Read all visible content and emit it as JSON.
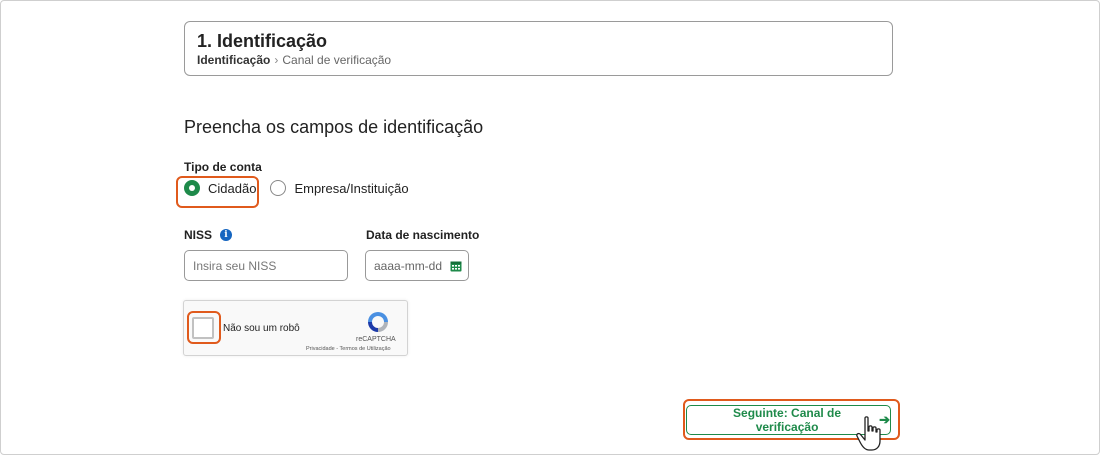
{
  "step": {
    "title": "1. Identificação",
    "breadcrumb": {
      "current": "Identificação",
      "separator": ">",
      "next": "Canal de verificação"
    }
  },
  "form": {
    "heading": "Preencha os campos de identificação",
    "account_type": {
      "label": "Tipo de conta",
      "options": [
        {
          "label": "Cidadão",
          "selected": true
        },
        {
          "label": "Empresa/Instituição",
          "selected": false
        }
      ]
    },
    "niss": {
      "label": "NISS",
      "placeholder": "Insira seu NISS",
      "value": ""
    },
    "birth_date": {
      "label": "Data de nascimento",
      "placeholder": "aaaa-mm-dd"
    },
    "captcha": {
      "label": "Não sou um robô",
      "brand": "reCAPTCHA",
      "links": "Privacidade - Termos de Utilização",
      "checked": false
    },
    "next_button": {
      "label": "Seguinte: Canal de verificação"
    }
  },
  "colors": {
    "accent": "#1e8a4a",
    "highlight": "#e05a1c",
    "info": "#1565c0"
  },
  "icons": {
    "info": "info-icon",
    "calendar": "calendar-icon",
    "arrow": "arrow-right-icon",
    "cursor": "hand-cursor-icon",
    "recaptcha": "recaptcha-logo-icon"
  }
}
